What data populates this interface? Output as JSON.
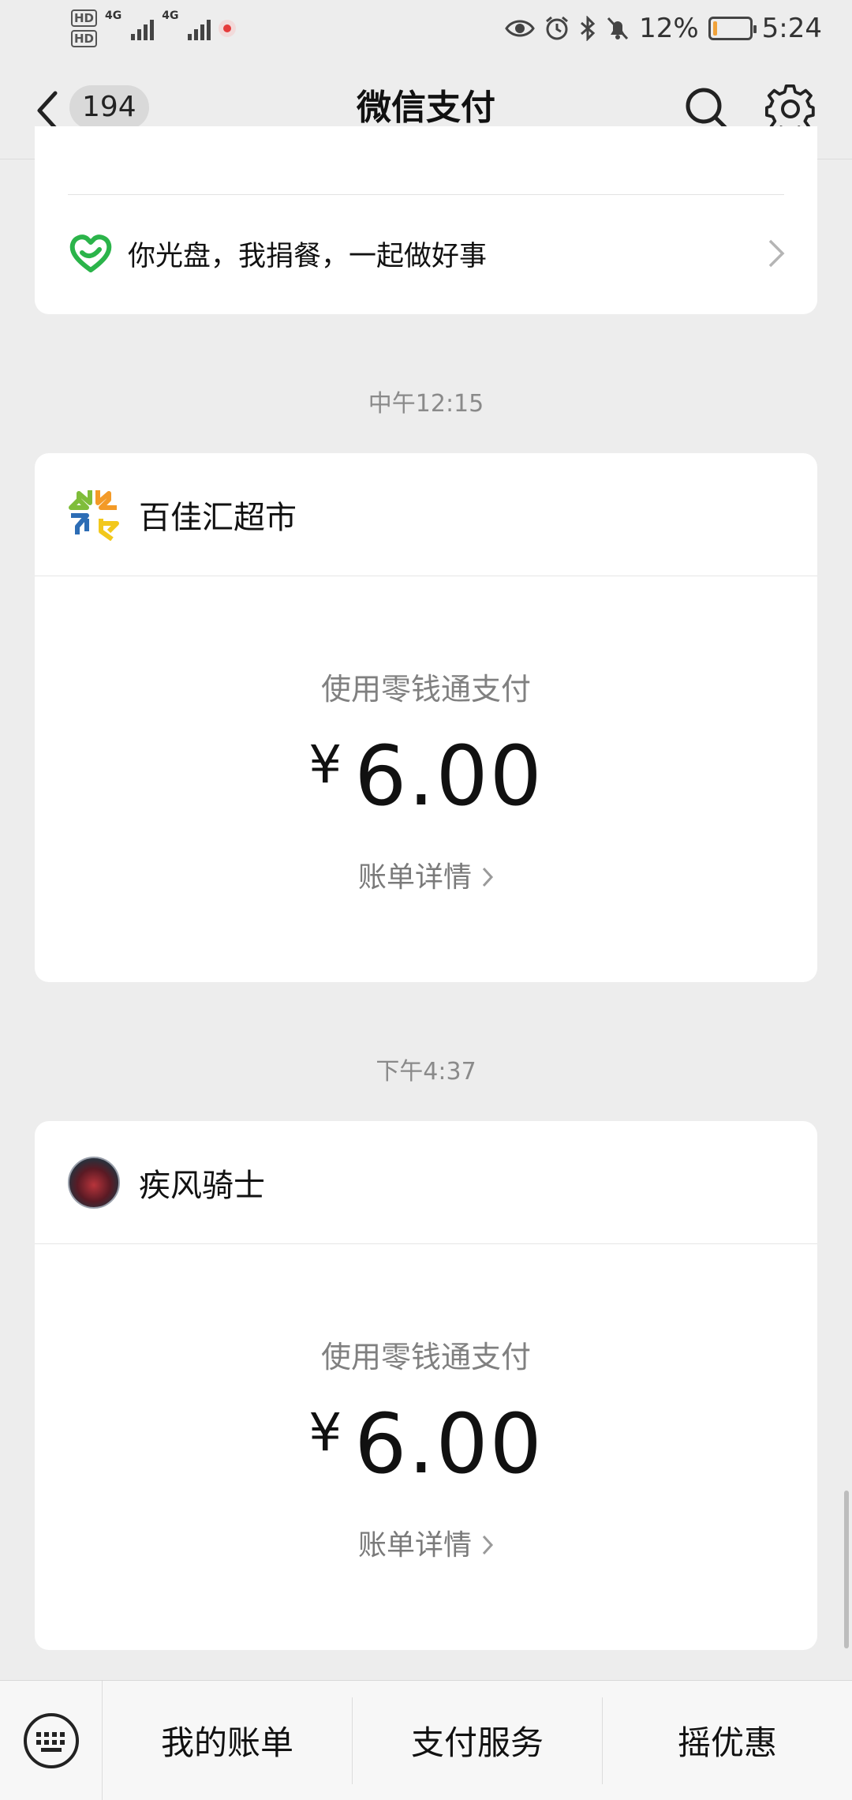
{
  "status_bar": {
    "hd1": "HD",
    "hd2": "HD",
    "net1": "4G",
    "net2": "4G",
    "battery_pct": "12%",
    "time": "5:24",
    "battery_level": 0.12
  },
  "nav": {
    "unread_count": "194",
    "title": "微信支付"
  },
  "top_card": {
    "promo_text": "你光盘，我捐餐，一起做好事"
  },
  "messages": [
    {
      "time": "中午12:15",
      "merchant": "百佳汇超市",
      "method": "使用零钱通支付",
      "currency": "¥",
      "amount": "6.00",
      "detail": "账单详情"
    },
    {
      "time": "下午4:37",
      "merchant": "疾风骑士",
      "method": "使用零钱通支付",
      "currency": "¥",
      "amount": "6.00",
      "detail": "账单详情"
    }
  ],
  "bottom_menu": {
    "item1": "我的账单",
    "item2": "支付服务",
    "item3": "摇优惠"
  },
  "colors": {
    "background": "#ededed",
    "card": "#ffffff",
    "brand_green": "#2bb44a"
  },
  "icons": [
    "back-arrow-icon",
    "search-icon",
    "gear-icon",
    "heart-leaf-icon",
    "chevron-right-icon",
    "keyboard-icon",
    "eye-icon",
    "alarm-icon",
    "bluetooth-icon",
    "mute-icon",
    "battery-icon"
  ]
}
